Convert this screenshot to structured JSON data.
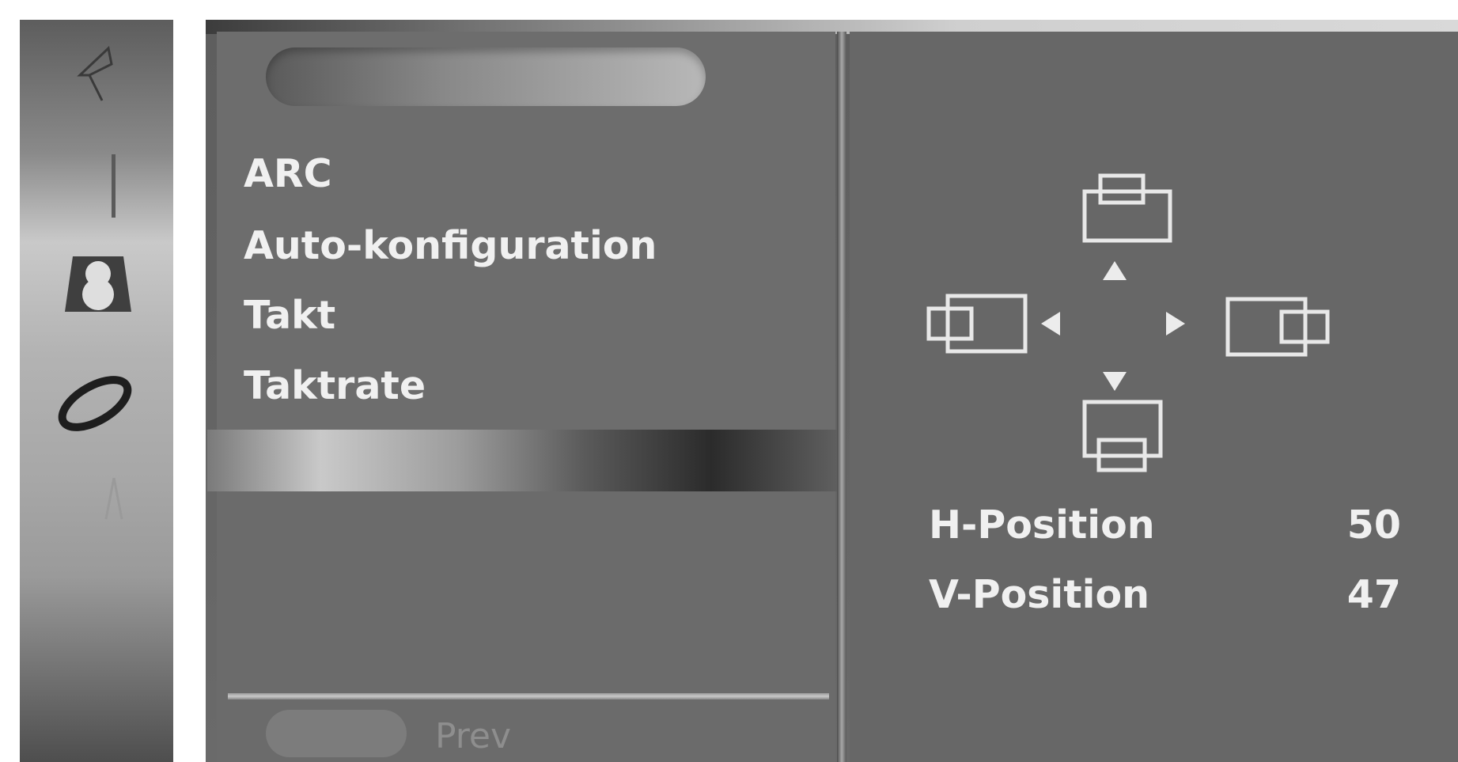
{
  "sidebar": {
    "icons": [
      "picture-icon",
      "audio-icon",
      "time-icon",
      "setup-icon",
      "option-icon"
    ]
  },
  "menu": {
    "title": "",
    "items": [
      {
        "label": "ARC"
      },
      {
        "label": "Auto-konfiguration"
      },
      {
        "label": "Takt"
      },
      {
        "label": "Taktrate"
      }
    ]
  },
  "footer": {
    "prev_label": "Prev"
  },
  "position": {
    "icons": [
      "move-up-icon",
      "move-left-icon",
      "move-right-icon",
      "move-down-icon"
    ],
    "h_label": "H-Position",
    "h_value": "50",
    "v_label": "V-Position",
    "v_value": "47"
  },
  "colors": {
    "panel": "#6d6d6d",
    "text": "#f0f0f0",
    "icon_stroke": "#e8e8e8"
  }
}
